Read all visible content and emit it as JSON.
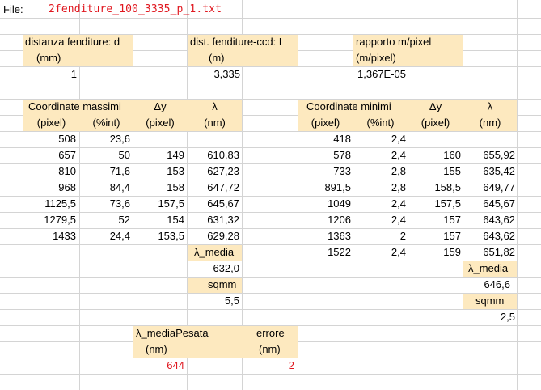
{
  "file": {
    "label": "File:",
    "name": "2fenditure_100_3335_p_1.txt"
  },
  "params": {
    "d": {
      "title": "distanza fenditure: d",
      "unit": "(mm)",
      "value": "1"
    },
    "L": {
      "title": "dist. fenditure-ccd: L",
      "unit": "(m)",
      "value": "3,335"
    },
    "ratio": {
      "title": "rapporto m/pixel",
      "unit": "(m/pixel)",
      "value": "1,367E-05"
    }
  },
  "massimi": {
    "header1": "Coordinate massimi",
    "header_dy": "Δy",
    "header_lambda": "λ",
    "col_pixel": "(pixel)",
    "col_int": "(%int)",
    "col_dy": "(pixel)",
    "col_lambda": "(nm)",
    "rows": [
      [
        "508",
        "23,6",
        "",
        ""
      ],
      [
        "657",
        "50",
        "149",
        "610,83"
      ],
      [
        "810",
        "71,6",
        "153",
        "627,23"
      ],
      [
        "968",
        "84,4",
        "158",
        "647,72"
      ],
      [
        "1125,5",
        "73,6",
        "157,5",
        "645,67"
      ],
      [
        "1279,5",
        "52",
        "154",
        "631,32"
      ],
      [
        "1433",
        "24,4",
        "153,5",
        "629,28"
      ]
    ],
    "lambda_media_label": "λ_media",
    "lambda_media": "632,0",
    "sqmm_label": "sqmm",
    "sqmm": "5,5"
  },
  "minimi": {
    "header1": "Coordinate minimi",
    "header_dy": "Δy",
    "header_lambda": "λ",
    "col_pixel": "(pixel)",
    "col_int": "(%int)",
    "col_dy": "(pixel)",
    "col_lambda": "(nm)",
    "rows": [
      [
        "418",
        "2,4",
        "",
        ""
      ],
      [
        "578",
        "2,4",
        "160",
        "655,92"
      ],
      [
        "733",
        "2,8",
        "155",
        "635,42"
      ],
      [
        "891,5",
        "2,8",
        "158,5",
        "649,77"
      ],
      [
        "1049",
        "2,4",
        "157,5",
        "645,67"
      ],
      [
        "1206",
        "2,4",
        "157",
        "643,62"
      ],
      [
        "1363",
        "2",
        "157",
        "643,62"
      ],
      [
        "1522",
        "2,4",
        "159",
        "651,82"
      ]
    ],
    "lambda_media_label": "λ_media",
    "lambda_media": "646,6",
    "sqmm_label": "sqmm",
    "sqmm": "2,5"
  },
  "summary": {
    "pesata_label": "λ_mediaPesata",
    "pesata_unit": "(nm)",
    "pesata_value": "644",
    "errore_label": "errore",
    "errore_unit": "(nm)",
    "errore_value": "2"
  },
  "colors": {
    "header_fill": "#fde9bf",
    "highlight_text": "#e0171f",
    "gridline": "#d4d4d4"
  }
}
